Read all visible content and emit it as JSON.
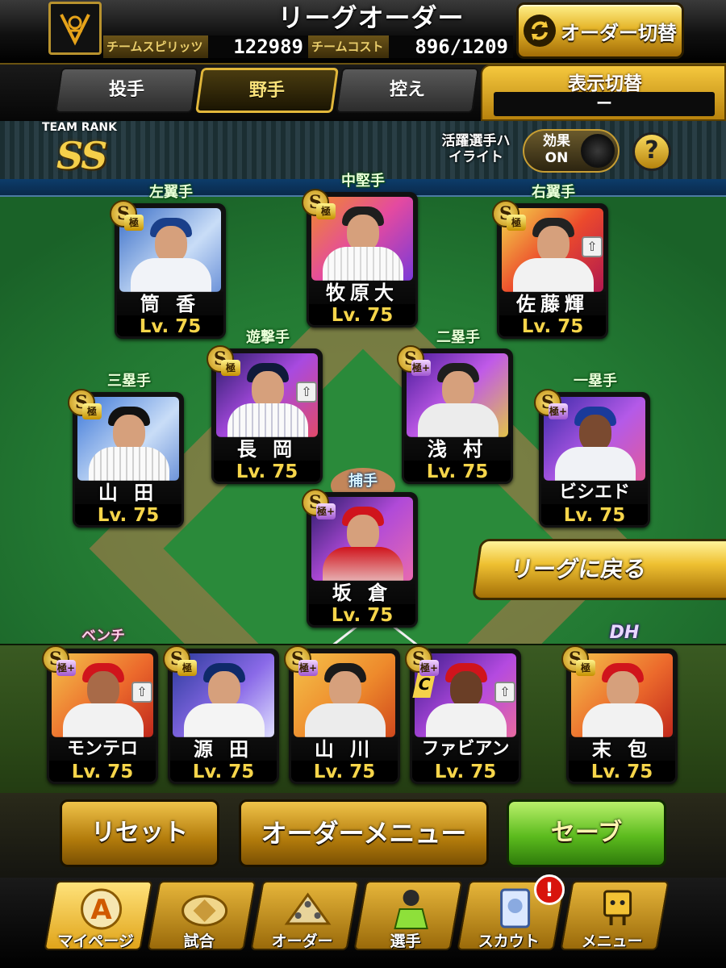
{
  "header": {
    "title": "リーグオーダー",
    "team_spirits_label": "チームスピリッツ",
    "team_spirits_value": "122989",
    "team_cost_label": "チームコスト",
    "team_cost_value": "896/1209",
    "order_switch_label": "オーダー切替"
  },
  "tabs": [
    {
      "label": "投手",
      "active": false
    },
    {
      "label": "野手",
      "active": true
    },
    {
      "label": "控え",
      "active": false
    }
  ],
  "display_switch": {
    "title": "表示切替",
    "value": "ー"
  },
  "team_rank": {
    "label": "TEAM RANK",
    "value": "SS"
  },
  "highlight": {
    "label": "活躍選手ハイライト",
    "toggle_label": "効果",
    "toggle_state": "ON",
    "help": "?"
  },
  "lineup": [
    {
      "position": "左翼手",
      "name": "筒 香",
      "level": "Lv. 75",
      "grade": "極"
    },
    {
      "position": "中堅手",
      "name": "牧原大",
      "level": "Lv. 75",
      "grade": "極"
    },
    {
      "position": "右翼手",
      "name": "佐藤輝",
      "level": "Lv. 75",
      "grade": "極"
    },
    {
      "position": "遊撃手",
      "name": "長 岡",
      "level": "Lv. 75",
      "grade": "極"
    },
    {
      "position": "二塁手",
      "name": "浅 村",
      "level": "Lv. 75",
      "grade": "極+"
    },
    {
      "position": "三塁手",
      "name": "山 田",
      "level": "Lv. 75",
      "grade": "極"
    },
    {
      "position": "一塁手",
      "name": "ビシエド",
      "level": "Lv. 75",
      "grade": "極+"
    },
    {
      "position": "捕手",
      "name": "坂 倉",
      "level": "Lv. 75",
      "grade": "極+"
    }
  ],
  "bench_label": "ベンチ",
  "dh_label": "DH",
  "bench": [
    {
      "name": "モンテロ",
      "level": "Lv. 75",
      "grade": "極+"
    },
    {
      "name": "源 田",
      "level": "Lv. 75",
      "grade": "極"
    },
    {
      "name": "山 川",
      "level": "Lv. 75",
      "grade": "極+"
    },
    {
      "name": "ファビアン",
      "level": "Lv. 75",
      "grade": "極+"
    }
  ],
  "dh": {
    "name": "末 包",
    "level": "Lv. 75",
    "grade": "極"
  },
  "return_league_label": "リーグに戻る",
  "actions": {
    "reset": "リセット",
    "order_menu": "オーダーメニュー",
    "save": "セーブ"
  },
  "nav": [
    {
      "label": "マイページ",
      "icon": "mypage-icon"
    },
    {
      "label": "試合",
      "icon": "stadium-icon"
    },
    {
      "label": "オーダー",
      "icon": "order-field-icon"
    },
    {
      "label": "選手",
      "icon": "player-icon"
    },
    {
      "label": "スカウト",
      "icon": "scout-card-icon"
    },
    {
      "label": "メニュー",
      "icon": "menu-box-icon"
    }
  ],
  "scout_alert": "!",
  "colors": {
    "gold": "#e5b52a",
    "level_text": "#f6d54a",
    "save_green": "#5cbb1e",
    "alert_red": "#d8140c"
  }
}
